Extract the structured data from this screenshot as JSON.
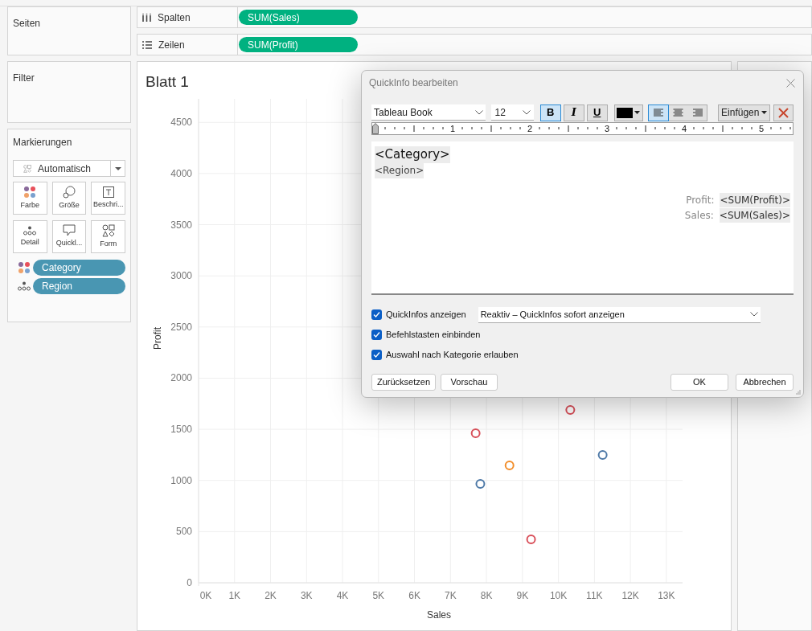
{
  "left_panel": {
    "pages": {
      "title": "Seiten"
    },
    "filters": {
      "title": "Filter"
    },
    "marks": {
      "title": "Markierungen",
      "mark_type": "Automatisch",
      "cards": [
        {
          "label": "Farbe",
          "kind": "color"
        },
        {
          "label": "Größe",
          "kind": "size"
        },
        {
          "label": "Beschri...",
          "kind": "label"
        },
        {
          "label": "Detail",
          "kind": "detail"
        },
        {
          "label": "Quickl...",
          "kind": "tooltip"
        },
        {
          "label": "Form",
          "kind": "shape"
        }
      ],
      "pills": [
        {
          "label": "Category",
          "kind": "color"
        },
        {
          "label": "Region",
          "kind": "detail"
        }
      ]
    }
  },
  "shelves": [
    {
      "label": "Spalten",
      "kind": "columns",
      "pill": "SUM(Sales)"
    },
    {
      "label": "Zeilen",
      "kind": "rows",
      "pill": "SUM(Profit)"
    }
  ],
  "sheet": {
    "title": "Blatt 1",
    "chart_data": {
      "type": "scatter",
      "xlabel": "Sales",
      "ylabel": "Profit",
      "x": [
        7700,
        7830,
        8640,
        9240,
        10330,
        11230
      ],
      "series": [
        {
          "color": "#d9505a",
          "values": [
            1462,
            null,
            null,
            425,
            1690,
            null
          ]
        },
        {
          "color": "#4e79a7",
          "values": [
            null,
            967,
            null,
            null,
            null,
            1250
          ]
        },
        {
          "color": "#f28e2b",
          "values": [
            null,
            null,
            1148,
            null,
            null,
            null
          ]
        }
      ],
      "grid": true,
      "xlim": [
        0,
        13450
      ],
      "ylim": [
        0,
        4730
      ],
      "xticks": [
        {
          "value": 0,
          "label": "0K"
        },
        {
          "value": 1000,
          "label": "1K"
        },
        {
          "value": 2000,
          "label": "2K"
        },
        {
          "value": 3000,
          "label": "3K"
        },
        {
          "value": 4000,
          "label": "4K"
        },
        {
          "value": 5000,
          "label": "5K"
        },
        {
          "value": 6000,
          "label": "6K"
        },
        {
          "value": 7000,
          "label": "7K"
        },
        {
          "value": 8000,
          "label": "8K"
        },
        {
          "value": 9000,
          "label": "9K"
        },
        {
          "value": 10000,
          "label": "10K"
        },
        {
          "value": 11000,
          "label": "11K"
        },
        {
          "value": 12000,
          "label": "12K"
        },
        {
          "value": 13000,
          "label": "13K"
        }
      ],
      "yticks": [
        0,
        500,
        1000,
        1500,
        2000,
        2500,
        3000,
        3500,
        4000,
        4500
      ]
    }
  },
  "dialog": {
    "title": "QuickInfo bearbeiten",
    "font": "Tableau Book",
    "size": "12",
    "format_buttons": [
      {
        "label": "B",
        "kind": "bold",
        "selected": true
      },
      {
        "label": "I",
        "kind": "italic",
        "selected": false
      },
      {
        "label": "U",
        "kind": "underline",
        "selected": false
      }
    ],
    "align_buttons": [
      {
        "kind": "left",
        "selected": true
      },
      {
        "kind": "center",
        "selected": false
      },
      {
        "kind": "right",
        "selected": false
      }
    ],
    "insert": "Einfügen",
    "ruler": [
      "1",
      "2",
      "3",
      "4",
      "5"
    ],
    "editor": {
      "header": [
        {
          "kind": "large",
          "text": "<Category>"
        },
        {
          "kind": "small",
          "text": "<Region>"
        }
      ],
      "fields": [
        {
          "label": "Profit:",
          "value": "<SUM(Profit)>"
        },
        {
          "label": "Sales:",
          "value": "<SUM(Sales)>"
        }
      ]
    },
    "options": [
      {
        "label": "QuickInfos anzeigen",
        "checked": true,
        "select": "Reaktiv – QuickInfos sofort anzeigen"
      },
      {
        "label": "Befehlstasten einbinden",
        "checked": true
      },
      {
        "label": "Auswahl nach Kategorie erlauben",
        "checked": true
      }
    ],
    "left_buttons": [
      "Zurücksetzen",
      "Vorschau"
    ],
    "right_buttons": [
      "OK",
      "Abbrechen"
    ]
  }
}
